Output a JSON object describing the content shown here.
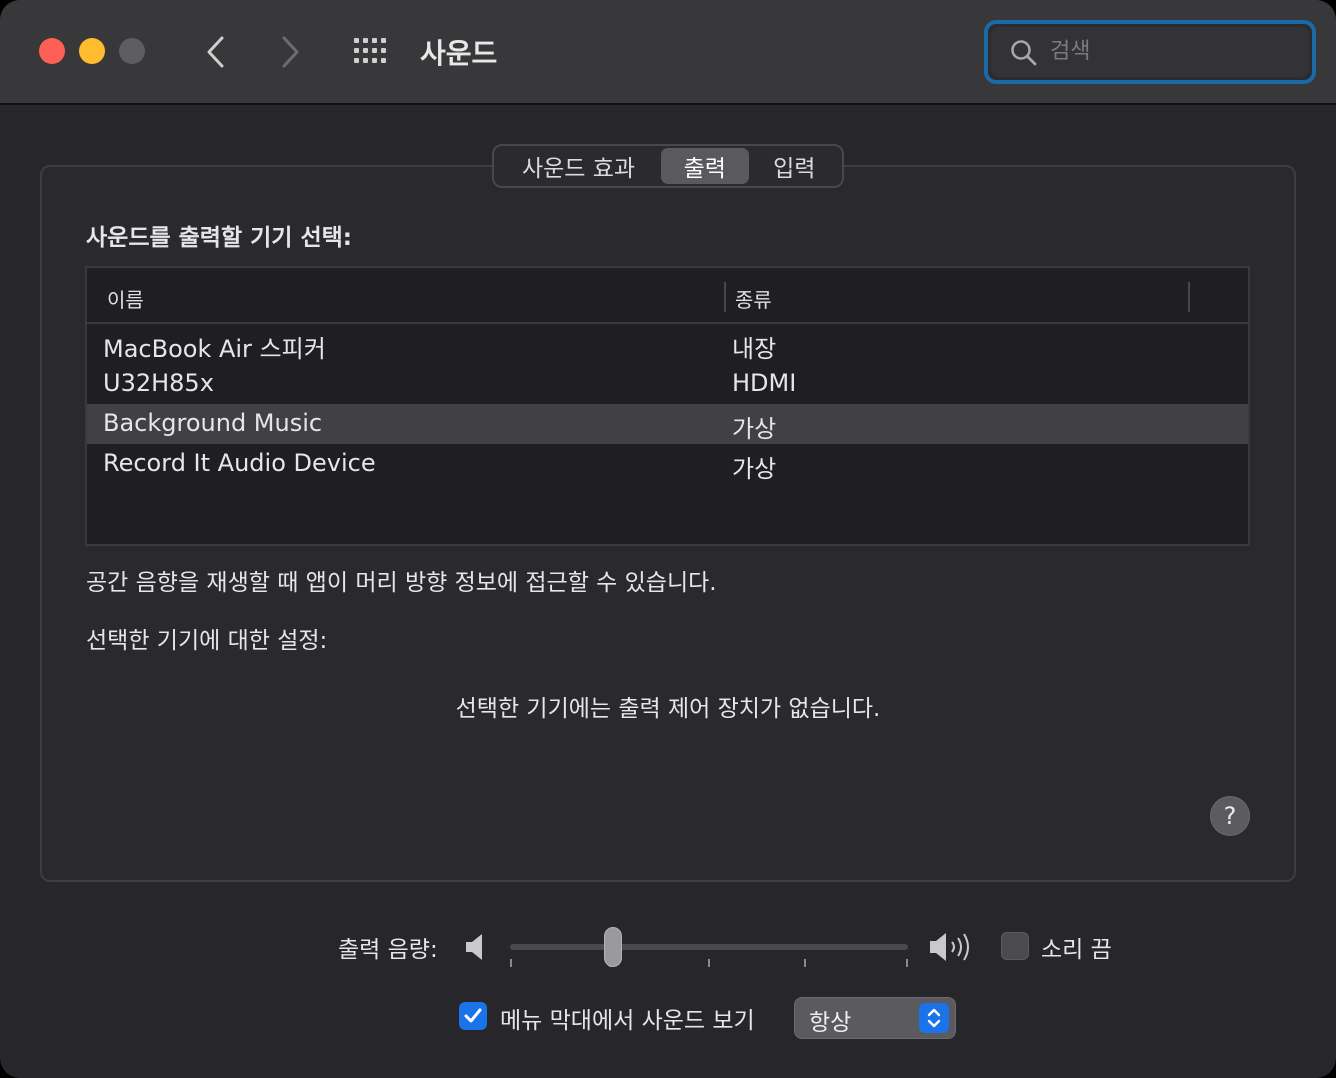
{
  "window": {
    "title": "사운드",
    "search": {
      "placeholder": "검색",
      "value": ""
    }
  },
  "tabs": [
    {
      "label": "사운드 효과",
      "selected": false
    },
    {
      "label": "출력",
      "selected": true
    },
    {
      "label": "입력",
      "selected": false
    }
  ],
  "output": {
    "section_label": "사운드를 출력할 기기 선택:",
    "columns": [
      "이름",
      "종류"
    ],
    "devices": [
      {
        "name": "MacBook Air 스피커",
        "type": "내장",
        "selected": false
      },
      {
        "name": "U32H85x",
        "type": "HDMI",
        "selected": false
      },
      {
        "name": "Background Music",
        "type": "가상",
        "selected": true
      },
      {
        "name": "Record It Audio Device",
        "type": "가상",
        "selected": false
      }
    ],
    "spatial_info": "공간 음향을 재생할 때 앱이 머리 방향 정보에 접근할 수 있습니다.",
    "settings_label": "선택한 기기에 대한 설정:",
    "no_controls": "선택한 기기에는 출력 제어 장치가 없습니다.",
    "help_label": "?"
  },
  "volume": {
    "label": "출력 음량:",
    "level": 0.26,
    "mute_label": "소리 끔",
    "muted": false
  },
  "menubar": {
    "label": "메뉴 막대에서 사운드 보기",
    "checked": true,
    "select_value": "항상"
  },
  "colors": {
    "accent": "#1a73e8",
    "close": "#fe5f57",
    "minimize": "#febc2e",
    "zoom_disabled": "#5e5d61"
  }
}
